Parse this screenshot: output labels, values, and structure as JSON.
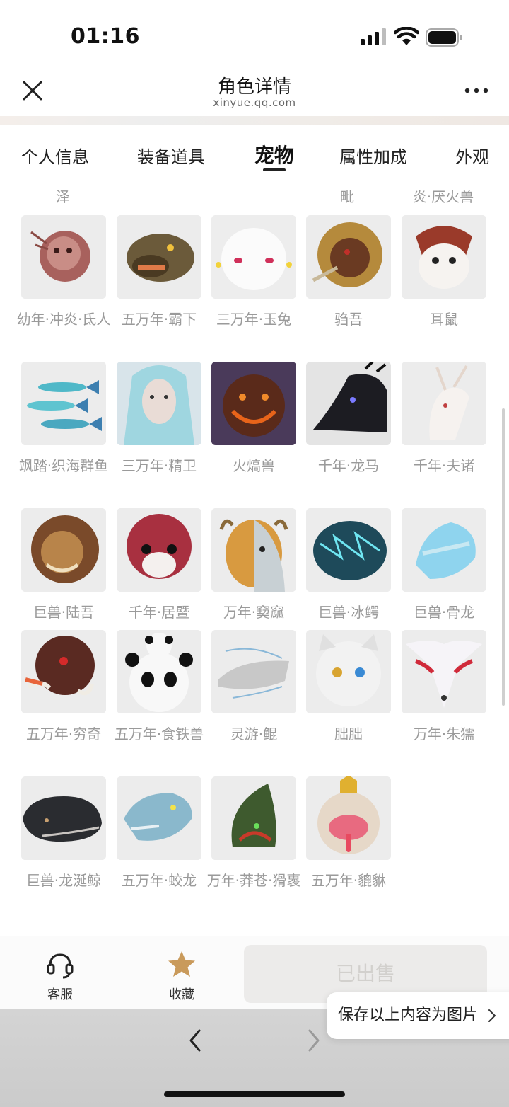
{
  "status_bar": {
    "time": "01:16"
  },
  "header": {
    "title": "角色详情",
    "url": "xinyue.qq.com"
  },
  "tabs": [
    {
      "label": "个人信息",
      "active": false
    },
    {
      "label": "装备道具",
      "active": false
    },
    {
      "label": "宠物",
      "active": true
    },
    {
      "label": "属性加成",
      "active": false
    },
    {
      "label": "外观",
      "active": false
    }
  ],
  "partial_labels": [
    "泽",
    "毗",
    "炎·厌火兽"
  ],
  "pets": [
    {
      "name": "幼年·冲炎·氐人"
    },
    {
      "name": "五万年·霸下"
    },
    {
      "name": "三万年·玉兔"
    },
    {
      "name": "驺吾"
    },
    {
      "name": "耳鼠"
    },
    {
      "name": "飒踏·织海群鱼"
    },
    {
      "name": "三万年·精卫"
    },
    {
      "name": "火熇兽"
    },
    {
      "name": "千年·龙马"
    },
    {
      "name": "千年·夫诸"
    },
    {
      "name": "巨兽·陆吾"
    },
    {
      "name": "千年·居暨"
    },
    {
      "name": "万年·窫窳"
    },
    {
      "name": "巨兽·冰鳄"
    },
    {
      "name": "巨兽·骨龙"
    },
    {
      "name": "五万年·穷奇"
    },
    {
      "name": "五万年·食铁兽"
    },
    {
      "name": "灵游·鲲"
    },
    {
      "name": "朏朏"
    },
    {
      "name": "万年·朱獳"
    },
    {
      "name": "巨兽·龙涎鲸"
    },
    {
      "name": "五万年·蛟龙"
    },
    {
      "name": "万年·莽苍·猾褢"
    },
    {
      "name": "五万年·貔貅"
    }
  ],
  "bottom_bar": {
    "service_label": "客服",
    "favorite_label": "收藏",
    "sold_label": "已出售"
  },
  "save_image_label": "保存以上内容为图片",
  "colors": {
    "accent_star": "#c99a5b",
    "sold_bg": "#ecebea",
    "label_gray": "#9a9a9a"
  }
}
